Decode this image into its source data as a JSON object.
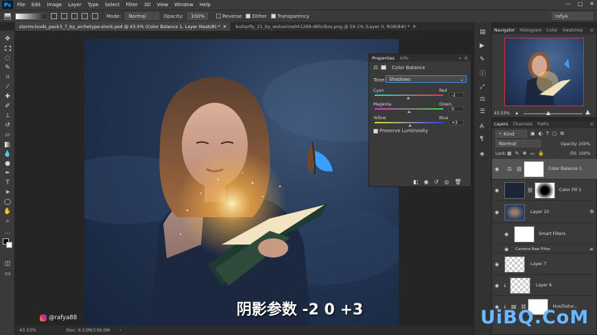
{
  "app": {
    "logo": "Ps"
  },
  "menu": [
    "File",
    "Edit",
    "Image",
    "Layer",
    "Type",
    "Select",
    "Filter",
    "3D",
    "View",
    "Window",
    "Help"
  ],
  "window_controls": [
    "—",
    "□",
    "✕"
  ],
  "options_bar": {
    "mode_label": "Mode:",
    "mode_value": "Normal",
    "opacity_label": "Opacity:",
    "opacity_value": "100%",
    "reverse_label": "Reverse",
    "dither_label": "Dither",
    "transparency_label": "Transparency",
    "workspace_value": "rafyA"
  },
  "tabs": [
    {
      "label": "stormclouds_pack3_7_by_archetype-stock.psd @ 43.5% (Color Balance 1, Layer Mask/8) *",
      "active": true
    },
    {
      "label": "butterfly_21_by_wolverine041269-d65clkos.png @ 59.1% (Layer 0, RGB/8#) *",
      "active": false
    }
  ],
  "status": {
    "zoom": "43.53%",
    "doc": "Doc: 9.53M/139.0M"
  },
  "properties": {
    "tabs": [
      "Properties",
      "Info"
    ],
    "title": "Color Balance",
    "tone_label": "Tone:",
    "tone_value": "Shadows",
    "sliders": [
      {
        "left": "Cyan",
        "right": "Red",
        "value": "-2",
        "fraction": 0.49,
        "gradient": [
          "#00e5e5",
          "#ff3030"
        ]
      },
      {
        "left": "Magenta",
        "right": "Green",
        "value": "0",
        "fraction": 0.5,
        "gradient": [
          "#e030e0",
          "#30e030"
        ]
      },
      {
        "left": "Yellow",
        "right": "Blue",
        "value": "+3",
        "fraction": 0.515,
        "gradient": [
          "#e5e530",
          "#3040ff"
        ]
      }
    ],
    "preserve_label": "Preserve Luminosity",
    "preserve_checked": true
  },
  "navigator": {
    "tabs": [
      "Navigator",
      "Histogram",
      "Color",
      "Swatches"
    ],
    "zoom": "43.53%"
  },
  "layers_panel": {
    "tabs": [
      "Layers",
      "Channels",
      "Paths"
    ],
    "filter_value": "Kind",
    "blend_value": "Normal",
    "opacity_label": "Opacity:",
    "opacity_value": "100%",
    "lock_label": "Lock:",
    "fill_label": "Fill:",
    "fill_value": "100%",
    "rows": [
      {
        "name": "Color Balance 1",
        "selected": true
      },
      {
        "name": "Color Fill 1",
        "selected": false
      },
      {
        "name": "Layer 10",
        "selected": false
      },
      {
        "name": "Smart Filters",
        "selected": false
      },
      {
        "name": "Camera Raw Filter",
        "selected": false
      },
      {
        "name": "Layer 7",
        "selected": false
      },
      {
        "name": "Layer 6",
        "selected": false
      },
      {
        "name": "Hue/Satur...",
        "selected": false
      }
    ]
  },
  "subtitle": "阴影参数 -2 0 +3",
  "handle": "@rafya88",
  "watermark": "UiBQ.CoM",
  "colors": {
    "accent": "#31a8ff",
    "nav_frame": "#e03030",
    "watermark": "#6fb8ff"
  }
}
